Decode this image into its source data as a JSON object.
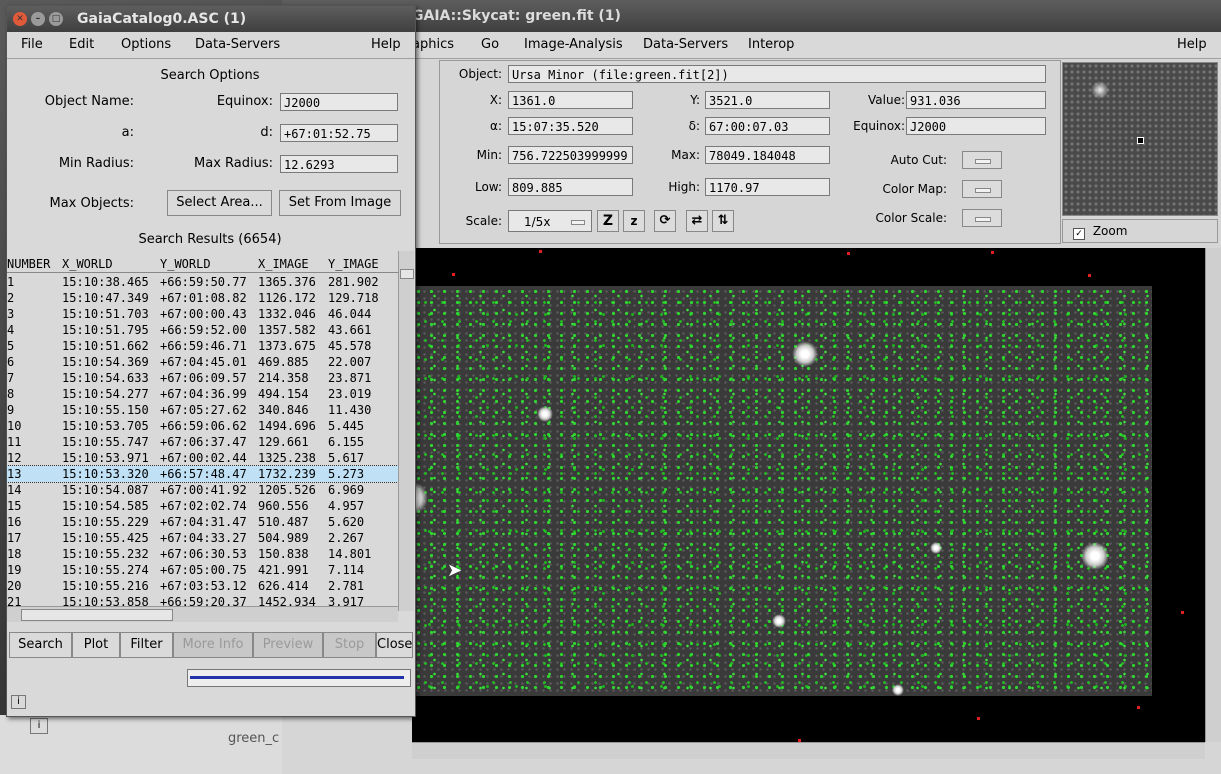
{
  "desktop": {
    "bottom_label": "green_c"
  },
  "skycat": {
    "title": "GAIA::Skycat: green.fit (1)",
    "menu": [
      "aphics",
      "Go",
      "Image-Analysis",
      "Data-Servers",
      "Interop"
    ],
    "help": "Help",
    "object_label": "Object:",
    "object_value": "Ursa Minor (file:green.fit[2])",
    "x_label": "X:",
    "x_value": "1361.0",
    "y_label": "Y:",
    "y_value": "3521.0",
    "value_label": "Value:",
    "value_value": "931.036",
    "alpha_label": "α:",
    "alpha_value": "15:07:35.520",
    "delta_label": "δ:",
    "delta_value": "67:00:07.03",
    "equinox_label": "Equinox:",
    "equinox_value": "J2000",
    "min_label": "Min:",
    "min_value": "756.722503999999",
    "max_label": "Max:",
    "max_value": "78049.184048",
    "autocut_label": "Auto Cut:",
    "low_label": "Low:",
    "low_value": "809.885",
    "high_label": "High:",
    "high_value": "1170.97",
    "colormap_label": "Color Map:",
    "scale_label": "Scale:",
    "scale_value": "1/5x",
    "colorscale_label": "Color Scale:",
    "zoom_label": "Zoom"
  },
  "catalog": {
    "title": "GaiaCatalog0.ASC (1)",
    "menu": [
      "File",
      "Edit",
      "Options",
      "Data-Servers"
    ],
    "help": "Help",
    "search_options": "Search Options",
    "object_name_label": "Object Name:",
    "equinox_label": "Equinox:",
    "equinox_value": "J2000",
    "a_label": "a:",
    "d_label": "d:",
    "d_value": "+67:01:52.75",
    "min_radius_label": "Min Radius:",
    "max_radius_label": "Max Radius:",
    "max_radius_value": "12.6293",
    "max_objects_label": "Max Objects:",
    "select_area": "Select Area...",
    "set_from_image": "Set From Image",
    "results_title": "Search Results (6654)",
    "columns": [
      "NUMBER",
      "X_WORLD",
      "Y_WORLD",
      "X_IMAGE",
      "Y_IMAGE"
    ],
    "rows": [
      [
        "1",
        "15:10:38.465",
        "+66:59:50.77",
        "1365.376",
        "281.902"
      ],
      [
        "2",
        "15:10:47.349",
        "+67:01:08.82",
        "1126.172",
        "129.718"
      ],
      [
        "3",
        "15:10:51.703",
        "+67:00:00.43",
        "1332.046",
        "46.044"
      ],
      [
        "4",
        "15:10:51.795",
        "+66:59:52.00",
        "1357.582",
        "43.661"
      ],
      [
        "5",
        "15:10:51.662",
        "+66:59:46.71",
        "1373.675",
        "45.578"
      ],
      [
        "6",
        "15:10:54.369",
        "+67:04:45.01",
        "469.885",
        "22.007"
      ],
      [
        "7",
        "15:10:54.633",
        "+67:06:09.57",
        "214.358",
        "23.871"
      ],
      [
        "8",
        "15:10:54.277",
        "+67:04:36.99",
        "494.154",
        "23.019"
      ],
      [
        "9",
        "15:10:55.150",
        "+67:05:27.62",
        "340.846",
        "11.430"
      ],
      [
        "10",
        "15:10:53.705",
        "+66:59:06.62",
        "1494.696",
        "5.445"
      ],
      [
        "11",
        "15:10:55.747",
        "+67:06:37.47",
        "129.661",
        "6.155"
      ],
      [
        "12",
        "15:10:53.971",
        "+67:00:02.44",
        "1325.238",
        "5.617"
      ],
      [
        "13",
        "15:10:53.320",
        "+66:57:48.47",
        "1732.239",
        "5.273"
      ],
      [
        "14",
        "15:10:54.087",
        "+67:00:41.92",
        "1205.526",
        "6.969"
      ],
      [
        "15",
        "15:10:54.585",
        "+67:02:02.74",
        "960.556",
        "4.957"
      ],
      [
        "16",
        "15:10:55.229",
        "+67:04:31.47",
        "510.487",
        "5.620"
      ],
      [
        "17",
        "15:10:55.425",
        "+67:04:33.27",
        "504.989",
        "2.267"
      ],
      [
        "18",
        "15:10:55.232",
        "+67:06:30.53",
        "150.838",
        "14.801"
      ],
      [
        "19",
        "15:10:55.274",
        "+67:05:00.75",
        "421.991",
        "7.114"
      ],
      [
        "20",
        "15:10:55.216",
        "+67:03:53.12",
        "626.414",
        "2.781"
      ],
      [
        "21",
        "15:10:53.858",
        "+66:59:20.37",
        "1452.934",
        "3.917"
      ]
    ],
    "selected_row": "13",
    "buttons": {
      "search": "Search",
      "plot": "Plot",
      "filter": "Filter",
      "more_info": "More Info",
      "preview": "Preview",
      "stop": "Stop",
      "close": "Close"
    },
    "info_icon": "i"
  }
}
